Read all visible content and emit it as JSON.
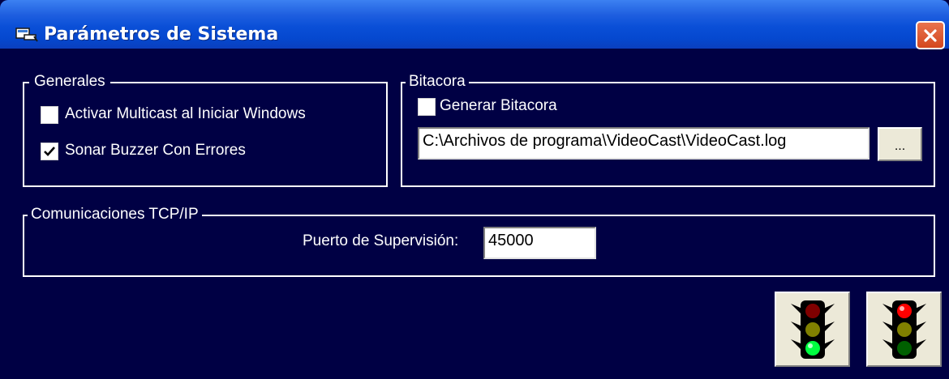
{
  "window": {
    "title": "Parámetros de Sistema",
    "close_icon": "close-icon",
    "app_icon": "window-app-icon"
  },
  "generales": {
    "legend": "Generales",
    "options": [
      {
        "label": "Activar Multicast al Iniciar Windows",
        "checked": false
      },
      {
        "label": "Sonar Buzzer Con Errores",
        "checked": true
      }
    ]
  },
  "bitacora": {
    "legend": "Bitacora",
    "generar_label": "Generar Bitacora",
    "generar_checked": false,
    "path_value": "C:\\Archivos de programa\\VideoCast\\VideoCast.log",
    "browse_label": "..."
  },
  "tcpip": {
    "legend": "Comunicaciones TCP/IP",
    "puerto_label": "Puerto de Supervisión:",
    "puerto_value": "45000"
  },
  "actions": {
    "start_icon": "traffic-light-green-icon",
    "stop_icon": "traffic-light-red-icon"
  },
  "colors": {
    "background": "#000044",
    "titlebar": "#0548cf",
    "close": "#d4471f",
    "button_face": "#ece9d8"
  }
}
